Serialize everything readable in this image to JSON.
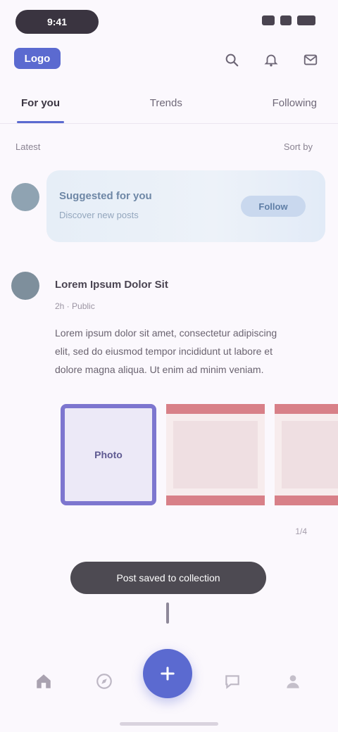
{
  "status_bar": {
    "time": "9:41"
  },
  "header": {
    "logo_text": "Logo",
    "icons": [
      "search-icon",
      "bell-icon",
      "mail-icon"
    ]
  },
  "tabs": [
    {
      "label": "For you",
      "active": true
    },
    {
      "label": "Trends",
      "active": false
    },
    {
      "label": "Following",
      "active": false
    }
  ],
  "filter": {
    "left_label": "Latest",
    "right_label": "Sort by"
  },
  "story": {
    "title": "Suggested for you",
    "subtitle": "Discover new posts",
    "button_label": "Follow"
  },
  "post": {
    "author": "Lorem Ipsum Dolor Sit",
    "meta": "2h · Public",
    "body": [
      "Lorem ipsum dolor sit amet, consectetur adipiscing",
      "elit, sed do eiusmod tempor incididunt ut labore et",
      "dolore magna aliqua. Ut enim ad minim veniam."
    ],
    "selected_tile_label": "Photo",
    "tile_count": "1/4"
  },
  "toast": {
    "message": "Post saved to collection"
  },
  "nav": {
    "items": [
      "home-icon",
      "explore-icon",
      "compose-icon",
      "chat-icon",
      "profile-icon"
    ]
  },
  "colors": {
    "accent": "#5b6ad0",
    "tile_selected": "#7d76cf",
    "tile_red": "#d88088"
  }
}
